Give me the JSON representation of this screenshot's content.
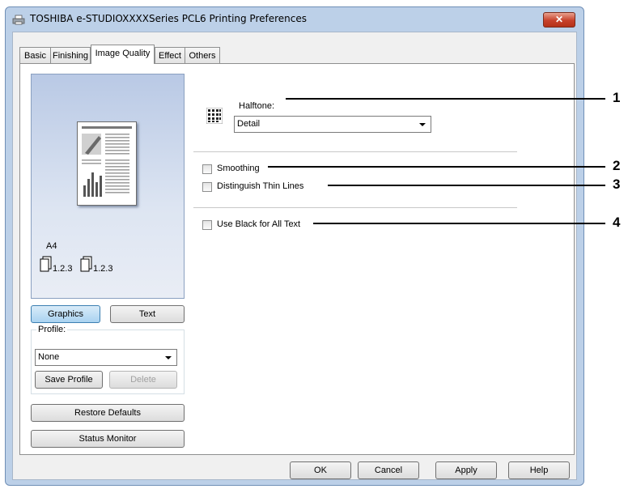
{
  "window": {
    "title": "TOSHIBA e-STUDIOXXXXSeries PCL6 Printing Preferences",
    "close_label": "✕"
  },
  "tabs": [
    {
      "label": "Basic"
    },
    {
      "label": "Finishing"
    },
    {
      "label": "Image Quality",
      "active": true
    },
    {
      "label": "Effect"
    },
    {
      "label": "Others"
    }
  ],
  "preview": {
    "paper_size": "A4",
    "copy_label_1": "1.2.3",
    "copy_label_2": "1.2.3"
  },
  "mode_buttons": {
    "graphics": "Graphics",
    "text": "Text"
  },
  "profile": {
    "label": "Profile:",
    "selected": "None",
    "save_label": "Save Profile",
    "delete_label": "Delete"
  },
  "restore_defaults_label": "Restore Defaults",
  "status_monitor_label": "Status Monitor",
  "halftone": {
    "label": "Halftone:",
    "selected": "Detail"
  },
  "options": {
    "smoothing": {
      "label": "Smoothing",
      "checked": false
    },
    "thin_lines": {
      "label": "Distinguish Thin Lines",
      "checked": false
    },
    "black_text": {
      "label": "Use Black for All Text",
      "checked": false
    }
  },
  "footer": {
    "ok": "OK",
    "cancel": "Cancel",
    "apply": "Apply",
    "help": "Help"
  },
  "callouts": [
    "1",
    "2",
    "3",
    "4"
  ]
}
